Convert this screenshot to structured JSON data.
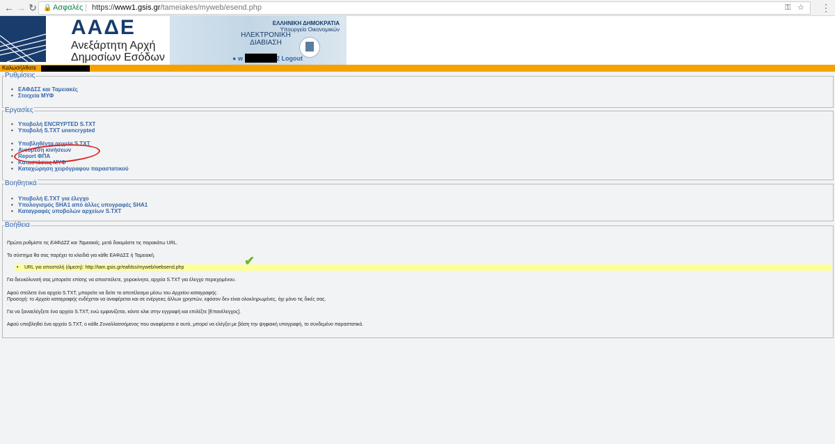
{
  "browser": {
    "secure_label": "Ασφαλές",
    "url_scheme": "https://",
    "url_host": "www1.gsis.gr",
    "url_path": "/tameiakes/myweb/esend.php"
  },
  "header": {
    "brand_title": "ΑΑΔΕ",
    "brand_sub1": "Ανεξάρτητη Αρχή",
    "brand_sub2": "Δημοσίων Εσόδων",
    "gov_title": "ΕΛΛΗΝΙΚΗ ΔΗΜΟΚΡΑΤΙΑ",
    "gov_ministry": "Υπουργείο Οικονομικών",
    "banner_line1": "ΗΛΕΚΤΡΟΝΙΚΗ",
    "banner_line2": "ΔΙΑΒΙΑΣΗ",
    "user_prefix": "w",
    "user_suffix": "2 Logout"
  },
  "welcome": "Καλωσήλθατε",
  "settings": {
    "legend": "Ρυθμίσεις",
    "items": [
      "ΕΑΦΔΣΣ και Ταμειακές",
      "Στοιχεία ΜΥΦ"
    ]
  },
  "tasks": {
    "legend": "Εργασίες",
    "items": [
      "Υποβολή ENCRYPTED S.TXT",
      "Υποβολή S.TXT unencrypted"
    ],
    "items2": [
      "Υποβληθέντα αρχεία S.TXT",
      "Ανεύρεση κινήσεων",
      "Report ΦΠΑ",
      "Καταστάσεις ΜΥΦ",
      "Καταχώρηση χειρόγραφου παραστατικού"
    ]
  },
  "tools": {
    "legend": "Βοηθητικά",
    "items": [
      "Υποβολή E.TXT για έλεγχο",
      "Υπολογισμός SHA1 από άλλες υπογραφές SHA1",
      "Καταγραφές υποβολών αρχείων S.TXT"
    ]
  },
  "help": {
    "legend": "Βοήθεια",
    "p1_a": "Πρώτα ρυθμίστε τις ",
    "p1_em": "ΕΑΦΔΣΣ και Ταμειακές",
    "p1_b": ", μετά δοκιμάστε τις παρακάτω URL.",
    "p2": "Το σύστημα θα σας παρέχει τα κλειδιά για κάθε ΕΑΦΔΣΣ ή Ταμειακή.",
    "url_line": "URL για αποστολή (άμεση): http://tam.gsis.gr/eafdss/myweb/websend.php",
    "p3": "Για διευκόλυνσή σας μπορείτε επίσης να αποστείλετε, χειροκίνητα, αρχεία S.TXT για έλεγχο περιεχομένου.",
    "p4_a": "Αφού στείλετε ένα αρχείο S.TXT, μπορείτε να δείτε το αποτέλεσμα μέσω του ",
    "p4_em": "Αρχείου καταγραφής",
    "p4_b": ".",
    "p5_a": "Προσοχή: το ",
    "p5_em": "Αρχείο καταγραφής",
    "p5_b": " ενδέχεται να αναφέρεται και σε ενέργειες άλλων χρηστών, εφόσον δεν είναι ολοκληρωμένες, όχι μόνο τις δικές σας.",
    "p6": "Για να ξαναελέγξετε ένα αρχείο S.TXT, ενώ εμφανίζεται, κάντε κλικ στην εγγραφή και επιλέξτε [Επανέλεγχος].",
    "p7_a": "Αφού υποβληθεί ένα αρχείο S.TXT, ο κάθε ",
    "p7_em": "Συναλλασσόμενος",
    "p7_b": " που αναφέρεται σ αυτό, μπορεί να ελέγξει με βάση την ψηφιακή υπογραφή, το συνδεμένο παραστατικό."
  }
}
